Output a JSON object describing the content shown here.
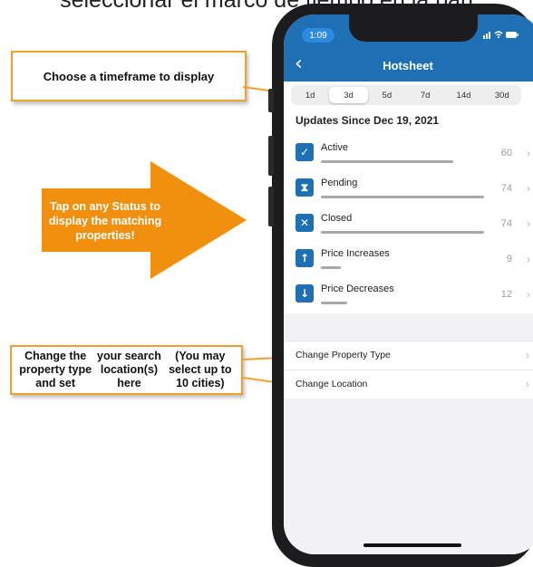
{
  "caption": "seleccionar el marco de tiempo en la pan",
  "callouts": {
    "timeframe": "Choose a timeframe to display",
    "status_lines": [
      "Tap on any Status to",
      "display the matching",
      "properties!"
    ],
    "property_lines": [
      "Change the property type and set",
      "your search location(s) here",
      "(You may select up to 10 cities)"
    ]
  },
  "colors": {
    "accent": "#f0a030",
    "header": "#1f6fb5",
    "arrow": "#f0900e"
  },
  "phone": {
    "time": "1:09",
    "status_icons": "signal wifi battery",
    "nav": {
      "back_icon": "chevron-left-icon",
      "title": "Hotsheet"
    },
    "tabs": [
      {
        "label": "1d",
        "active": false
      },
      {
        "label": "3d",
        "active": true
      },
      {
        "label": "5d",
        "active": false
      },
      {
        "label": "7d",
        "active": false
      },
      {
        "label": "14d",
        "active": false
      },
      {
        "label": "30d",
        "active": false
      }
    ],
    "updates_title": "Updates Since Dec 19, 2021",
    "statuses": [
      {
        "label": "Active",
        "count": "60",
        "icon": "check-icon",
        "glyph": "✓",
        "fill": 0.81
      },
      {
        "label": "Pending",
        "count": "74",
        "icon": "hourglass-icon",
        "glyph": "⧗",
        "fill": 1.0
      },
      {
        "label": "Closed",
        "count": "74",
        "icon": "close-icon",
        "glyph": "✕",
        "fill": 1.0
      },
      {
        "label": "Price Increases",
        "count": "9",
        "icon": "arrow-up-icon",
        "glyph": "↑",
        "fill": 0.12
      },
      {
        "label": "Price Decreases",
        "count": "12",
        "icon": "arrow-down-icon",
        "glyph": "↓",
        "fill": 0.16
      }
    ],
    "settings": [
      {
        "label": "Change Property Type"
      },
      {
        "label": "Change Location"
      }
    ]
  }
}
